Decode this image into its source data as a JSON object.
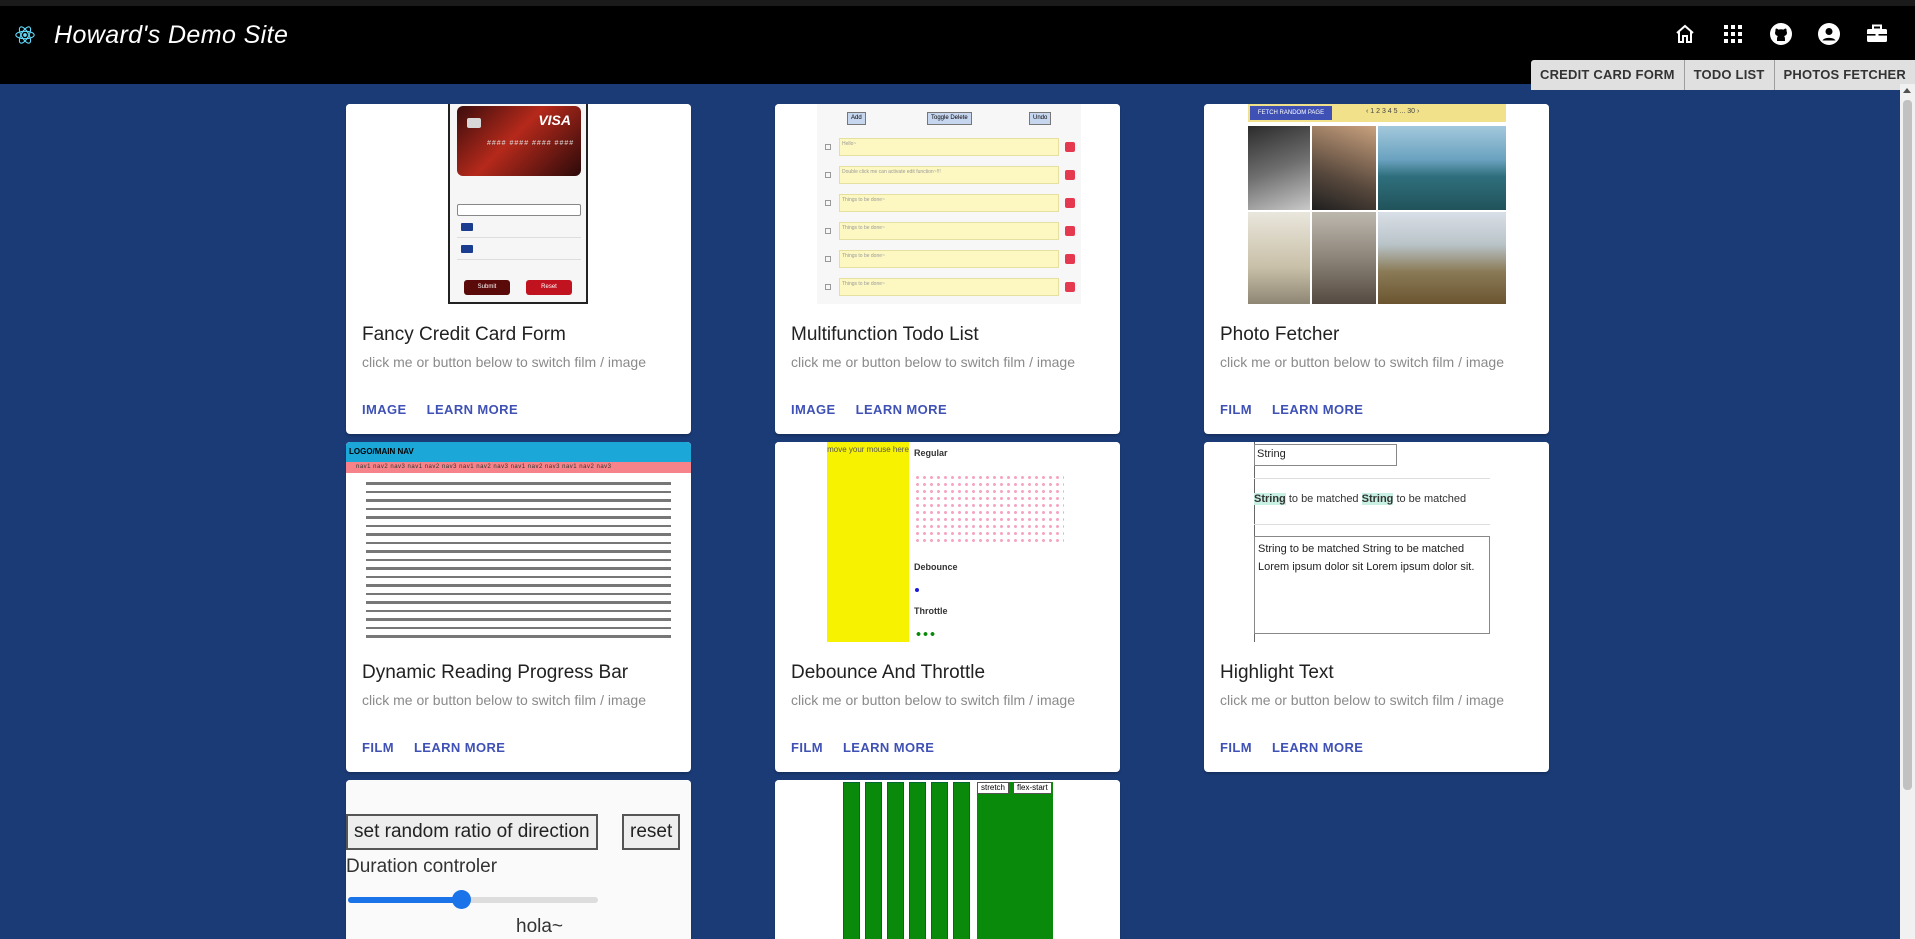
{
  "header": {
    "title": "Howard's Demo Site",
    "icons": [
      "home-icon",
      "apps-icon",
      "github-icon",
      "account-icon",
      "work-icon"
    ],
    "tabs": [
      "CREDIT CARD FORM",
      "TODO LIST",
      "PHOTOS FETCHER"
    ]
  },
  "cards": [
    {
      "title": "Fancy Credit Card Form",
      "desc": "click me or button below to switch film / image",
      "toggle": "IMAGE",
      "more": "LEARN MORE"
    },
    {
      "title": "Multifunction Todo List",
      "desc": "click me or button below to switch film / image",
      "toggle": "IMAGE",
      "more": "LEARN MORE"
    },
    {
      "title": "Photo Fetcher",
      "desc": "click me or button below to switch film / image",
      "toggle": "FILM",
      "more": "LEARN MORE"
    },
    {
      "title": "Dynamic Reading Progress Bar",
      "desc": "click me or button below to switch film / image",
      "toggle": "FILM",
      "more": "LEARN MORE"
    },
    {
      "title": "Debounce And Throttle",
      "desc": "click me or button below to switch film / image",
      "toggle": "FILM",
      "more": "LEARN MORE"
    },
    {
      "title": "Highlight Text",
      "desc": "click me or button below to switch film / image",
      "toggle": "FILM",
      "more": "LEARN MORE"
    }
  ],
  "previews": {
    "credit_card": {
      "brand": "VISA",
      "number": "#### #### #### ####",
      "submit": "Submit",
      "reset": "Reset"
    },
    "todo": {
      "buttons": [
        "Add",
        "Toggle Delete",
        "Undo"
      ],
      "rows": [
        "Hello~",
        "Double click me can activate edit function~!!!",
        "Things to be done~",
        "Things to be done~",
        "Things to be done~",
        "Things to be done~"
      ]
    },
    "photo": {
      "fetch": "FETCH RANDOM PAGE",
      "pages": "‹ 1 2 3 4 5 ... 30 ›"
    },
    "reading": {
      "logo": "LOGO/MAIN NAV",
      "nav": "nav1 nav2 nav3 nav1 nav2 nav3 nav1 nav2 nav3 nav1 nav2 nav3 nav1 nav2 nav3"
    },
    "debounce": {
      "hint": "move your mouse here",
      "regular": "Regular",
      "debounce": "Debounce",
      "throttle": "Throttle"
    },
    "highlight": {
      "input": "String",
      "word": "String",
      "rest": " to be matched ",
      "area": "String to be matched String to be matched Lorem ipsum dolor sit Lorem ipsum dolor sit."
    },
    "duration": {
      "random_btn": "set random ratio of direction",
      "reset_btn": "reset",
      "label": "Duration controler",
      "slider_fraction": 0.45,
      "hola": "hola~"
    },
    "flex": {
      "stretch": "stretch",
      "flex_start": "flex-start"
    }
  },
  "colors": {
    "background": "#1b3b77",
    "header": "#000000",
    "accent": "#3f51b5"
  }
}
